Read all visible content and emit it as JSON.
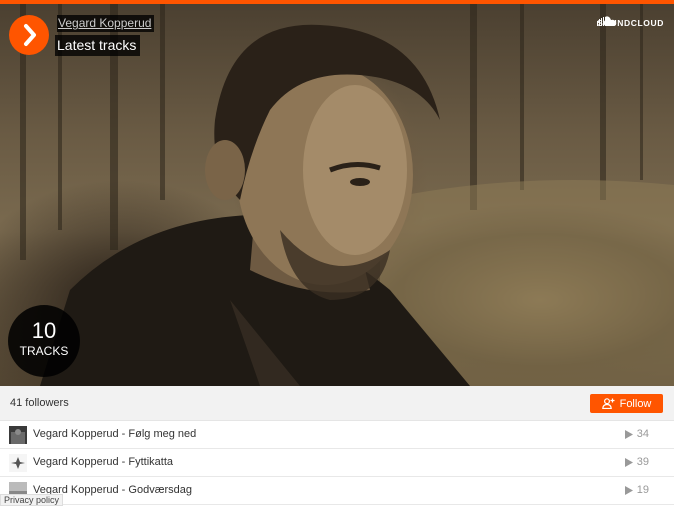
{
  "header": {
    "user_name": "Vegard Kopperud",
    "set_title": "Latest tracks",
    "logo_text": "SOUNDCLOUD"
  },
  "artwork": {
    "track_count": "10",
    "track_count_label": "TRACKS"
  },
  "footer": {
    "followers": "41 followers",
    "follow_label": "Follow"
  },
  "tracks": [
    {
      "title": "Vegard Kopperud - Følg meg ned",
      "plays": "34"
    },
    {
      "title": "Vegard Kopperud - Fyttikatta",
      "plays": "39"
    },
    {
      "title": "Vegard Kopperud - Godværsdag",
      "plays": "19"
    }
  ],
  "privacy_label": "Privacy policy",
  "colors": {
    "accent": "#ff5500",
    "overlay": "#000000"
  },
  "icons": [
    "play-icon",
    "soundcloud-cloud-icon",
    "add-user-icon",
    "play-count-icon"
  ]
}
